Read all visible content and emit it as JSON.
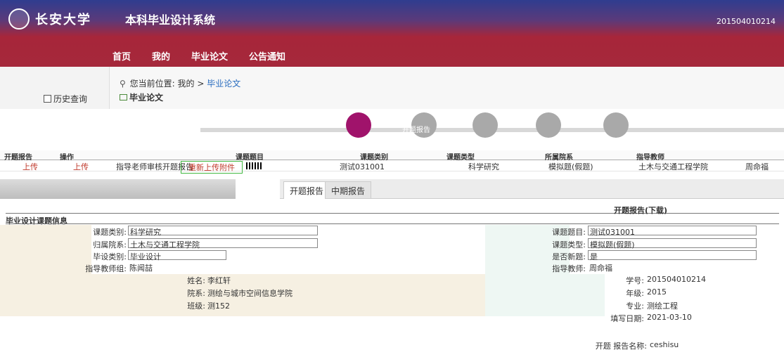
{
  "header": {
    "school_name": "长安大学",
    "system_title": "本科毕业设计系统",
    "user_info": "201504010214",
    "nav": [
      "首页",
      "我的",
      "毕业论文",
      "公告通知"
    ]
  },
  "sidebar": {
    "history": "历史查询"
  },
  "breadcrumb": {
    "prefix": "您当前位置:",
    "my": "我的",
    "separator": ">",
    "current": "毕业论文"
  },
  "section_title": "毕业论文",
  "steps": {
    "active_label": "开题报告"
  },
  "table": {
    "headers": [
      "开题报告",
      "操作",
      "课题题目",
      "课题类别",
      "课题类型",
      "所属院系",
      "指导教师"
    ],
    "row": {
      "upload_1": "上传",
      "upload_2": "上传",
      "status": "指导老师审核开题报告",
      "reupload": "重新上传附件",
      "topic": "测试031001",
      "category": "科学研究",
      "type": "模拟题(假题)",
      "department": "土木与交通工程学院",
      "teacher": "周命福"
    }
  },
  "tabs": [
    "开题报告",
    "中期报告"
  ],
  "report": {
    "title": "开题报告(下载)",
    "left_section": "毕业设计课题信息",
    "fields_left": [
      {
        "label": "课题类别:",
        "value": "科学研究"
      },
      {
        "label": "归属院系:",
        "value": "土木与交通工程学院"
      },
      {
        "label": "毕设类别:",
        "value": "毕业设计"
      },
      {
        "label": "指导教师组:",
        "value": "陈闻喆"
      }
    ],
    "fields_right": [
      {
        "label": "课题题目:",
        "value": "测试031001"
      },
      {
        "label": "课题类型:",
        "value": "模拟题(假题)"
      },
      {
        "label": "是否新题:",
        "value": "是"
      },
      {
        "label": "指导教师:",
        "value": "周命福"
      }
    ],
    "student_left": [
      {
        "label": "姓名:",
        "value": "李红轩"
      },
      {
        "label": "院系:",
        "value": "测绘与城市空间信息学院"
      },
      {
        "label": "班级:",
        "value": "测152"
      }
    ],
    "student_right": [
      {
        "label": "学号:",
        "value": "201504010214"
      },
      {
        "label": "年级:",
        "value": "2015"
      },
      {
        "label": "专业:",
        "value": "测绘工程"
      },
      {
        "label": "填写日期:",
        "value": "2021-03-10"
      }
    ],
    "report_name_label": "开题 报告名称:",
    "report_name_value": "ceshisu"
  },
  "colors": {
    "accent_red": "#a5283b",
    "link_blue": "#2a6dbf",
    "active_step": "#a0136b"
  }
}
